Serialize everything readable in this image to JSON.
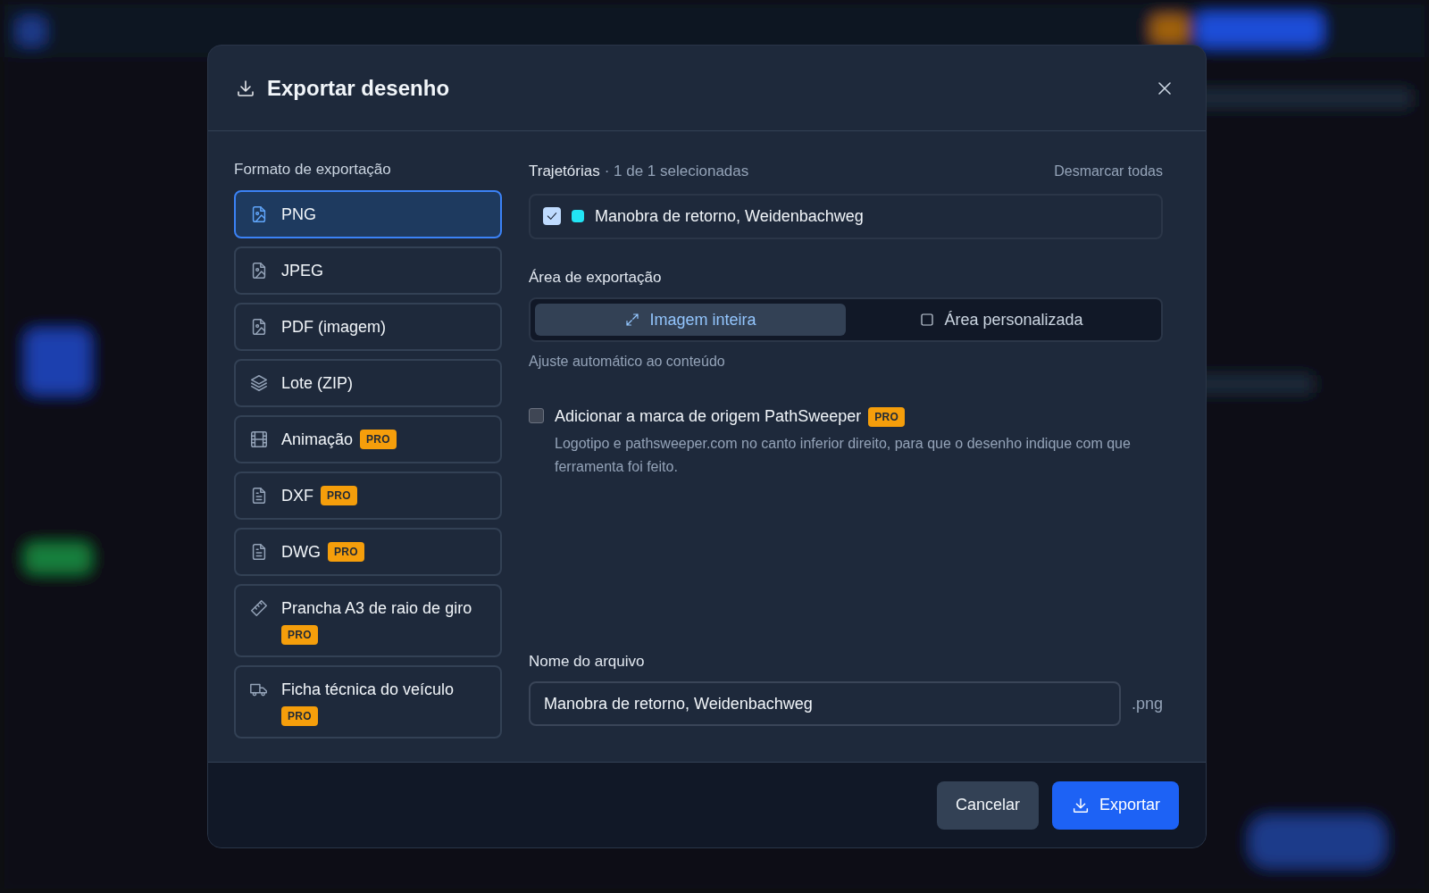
{
  "dialog": {
    "title": "Exportar desenho"
  },
  "formats": {
    "heading": "Formato de exportação",
    "items": [
      {
        "label": "PNG",
        "selected": true
      },
      {
        "label": "JPEG",
        "selected": false
      },
      {
        "label": "PDF (imagem)",
        "selected": false
      },
      {
        "label": "Lote (ZIP)",
        "selected": false
      },
      {
        "label": "Animação",
        "badge": "PRO",
        "selected": false
      },
      {
        "label": "DXF",
        "badge": "PRO",
        "selected": false
      },
      {
        "label": "DWG",
        "badge": "PRO",
        "selected": false
      },
      {
        "label": "Prancha A3 de raio de giro",
        "badge": "PRO",
        "selected": false
      },
      {
        "label": "Ficha técnica do veículo",
        "badge": "PRO",
        "selected": false
      }
    ]
  },
  "trajectories": {
    "heading": "Trajetórias",
    "count": "· 1 de 1 selecionadas",
    "action": "Desmarcar todas",
    "items": [
      {
        "label": "Manobra de retorno, Weidenbachweg",
        "checked": true,
        "color": "#22e5f5"
      }
    ]
  },
  "export_area": {
    "heading": "Área de exportação",
    "options": [
      {
        "label": "Imagem inteira",
        "selected": true
      },
      {
        "label": "Área personalizada",
        "selected": false
      }
    ],
    "hint": "Ajuste automático ao conteúdo"
  },
  "watermark": {
    "label": "Adicionar a marca de origem PathSweeper",
    "badge": "PRO",
    "checked": false,
    "description": "Logotipo e pathsweeper.com no canto inferior direito, para que o desenho indique com que ferramenta foi feito."
  },
  "file_name": {
    "label": "Nome do arquivo",
    "value": "Manobra de retorno, Weidenbachweg",
    "extension": ".png"
  },
  "buttons": [
    {
      "label": "Cancelar",
      "kind": "secondary"
    },
    {
      "label": "Exportar",
      "kind": "primary"
    }
  ]
}
